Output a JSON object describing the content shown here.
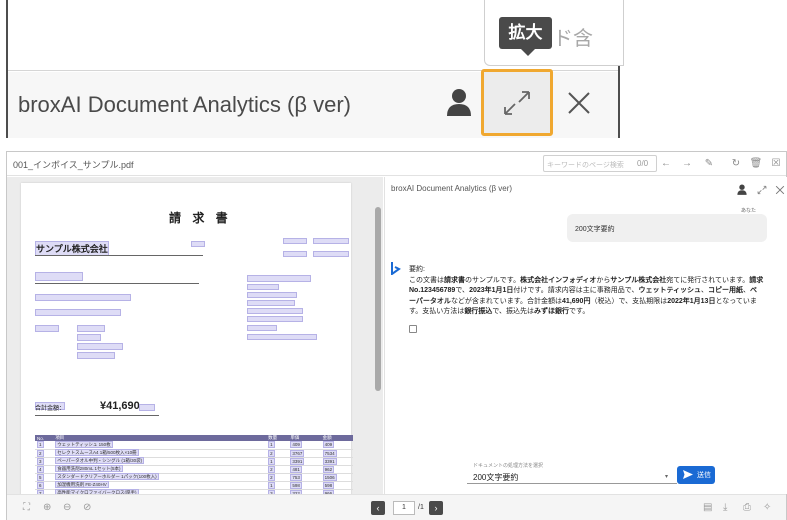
{
  "zoom": {
    "tooltip": "拡大",
    "search_placeholder": "ワード含",
    "title": "broxAI Document Analytics (β ver)"
  },
  "topbar": {
    "filename": "001_インボイス_サンプル.pdf",
    "search_placeholder": "キーワードのページ検索",
    "search_count": "0/0"
  },
  "document": {
    "title": "請 求 書",
    "company": "サンプル株式会社",
    "total_label": "合計金額：",
    "total": "¥41,690",
    "item_headers": [
      "No.",
      "項目",
      "数量",
      "単価",
      "金額"
    ],
    "items": [
      [
        "1",
        "ウェットティッシュ 150枚",
        "1",
        "409",
        "409"
      ],
      [
        "2",
        "セレクトスムースA4 1箱/500枚入×10冊",
        "2",
        "3767",
        "7534"
      ],
      [
        "3",
        "ペーパータオル中判・シングル (1箱/30袋)",
        "1",
        "3391",
        "3391"
      ],
      [
        "4",
        "食器用洗剤280mL 1セット(5本)",
        "2",
        "481",
        "962"
      ],
      [
        "5",
        "スタンダードクリアーホルダー 1パック(100枚入)",
        "2",
        "753",
        "1506"
      ],
      [
        "6",
        "加湿機用洗剤 FE-Z40HV",
        "1",
        "598",
        "598"
      ],
      [
        "7",
        "高性能マイクロファイバークロス(厚手)",
        "3",
        "322",
        "966"
      ]
    ]
  },
  "chat": {
    "title": "broxAI Document Analytics (β ver)",
    "you_label": "あなた",
    "user_message": "200文字要約",
    "response_label": "要約:",
    "response_line1_pre": "この文書は",
    "response_line1_b1": "請求書",
    "response_line1_mid": "のサンプルです。",
    "response_line1_b2": "株式会社インフォディオ",
    "response_line1_mid2": "から",
    "response_line1_b3": "サンプル株式会社",
    "response_line1_post": "宛てに発行されています。",
    "response_line1_b4": "請求",
    "response_line2_b1": "No.123456789",
    "response_line2_mid": "で、",
    "response_line2_b2": "2023年1月1日",
    "response_line2_post": "付けです。請求内容は主に事務用品で、",
    "response_line2_b3": "ウェットティッシュ",
    "response_line2_sep": "、",
    "response_line2_b4": "コピー用紙",
    "response_line2_end": "、",
    "response_line2_b5": "ペ",
    "response_line3_b1": "ーパータオル",
    "response_line3_mid": "などが含まれています。合計金額は",
    "response_line3_b2": "41,690円",
    "response_line3_post": "（税込）で、支払期限は",
    "response_line3_b3": "2022年1月13日",
    "response_line3_end": "となっていま",
    "response_line4_pre": "す。支払い方法は",
    "response_line4_b1": "銀行振込",
    "response_line4_mid": "で、振込先は",
    "response_line4_b2": "みずほ銀行",
    "response_line4_post": "です。",
    "select_label": "ドキュメントの処理方法を選択",
    "select_value": "200文字要約",
    "send_label": "送信"
  },
  "pager": {
    "current": "1",
    "total": "/1"
  }
}
